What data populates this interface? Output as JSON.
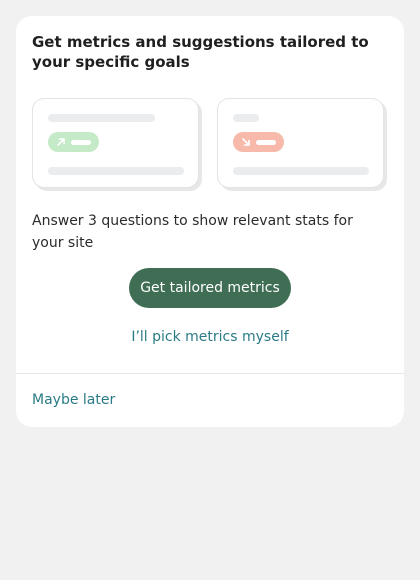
{
  "card": {
    "title": "Get metrics and suggestions tailored to your specific goals",
    "description": "Answer 3 questions to show relevant stats for your site",
    "primary_button_label": "Get tailored metrics",
    "pick_link_label": "I’ll pick metrics myself",
    "later_link_label": "Maybe later"
  },
  "previews": [
    {
      "icon": "arrow-up-right-icon",
      "accent": "#c4eac8",
      "icon_color": "#ffffff"
    },
    {
      "icon": "arrow-down-right-icon",
      "accent": "#f7b9a9",
      "icon_color": "#ffffff"
    }
  ],
  "colors": {
    "background": "#f1f1f1",
    "card": "#ffffff",
    "primary_button": "#3f6e55",
    "link": "#2a7b86"
  }
}
